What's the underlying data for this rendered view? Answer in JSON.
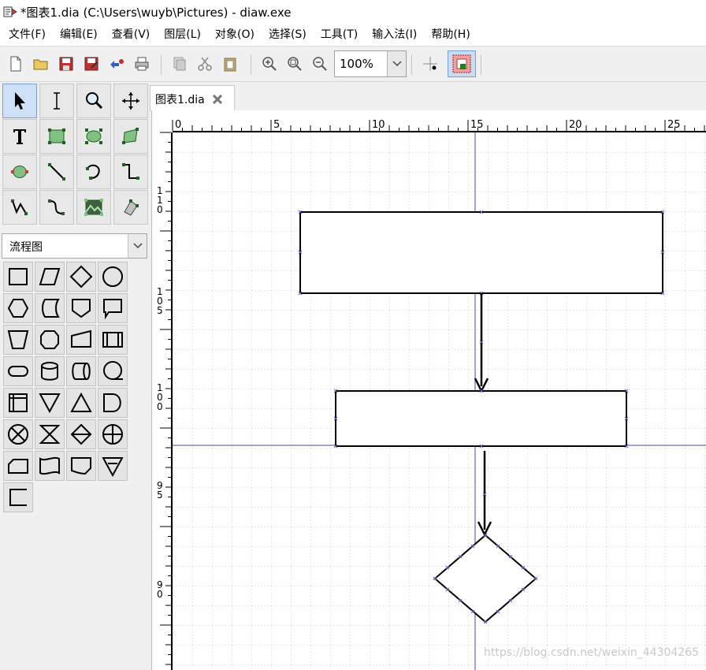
{
  "window": {
    "title": "*图表1.dia (C:\\Users\\wuyb\\Pictures) - diaw.exe"
  },
  "menu": [
    "文件(F)",
    "编辑(E)",
    "查看(V)",
    "图层(L)",
    "对象(O)",
    "选择(S)",
    "工具(T)",
    "输入法(I)",
    "帮助(H)"
  ],
  "toolbar": {
    "buttons": [
      "new-icon",
      "open-icon",
      "save-icon",
      "save-as-icon",
      "export-icon",
      "print-icon",
      "copy-icon",
      "cut-icon",
      "paste-icon",
      "zoom-in-icon",
      "zoom-fit-icon",
      "zoom-out-icon",
      "snap-grid-icon",
      "snap-objects-icon"
    ],
    "zoom_value": "100%"
  },
  "tools": [
    "pointer-icon",
    "text-cursor-icon",
    "magnify-icon",
    "move-icon",
    "text-tool-icon",
    "box-icon",
    "ellipse-icon",
    "polygon-icon",
    "bezier-icon",
    "line-icon",
    "arc-icon",
    "zigzag-icon",
    "polyline-icon",
    "bezierline-icon",
    "image-icon",
    "outline-icon"
  ],
  "sheet": {
    "selected": "流程图"
  },
  "shapes": [
    "process",
    "input-output",
    "decision",
    "connector",
    "preparation",
    "stored-data",
    "offpage",
    "document",
    "manual-operation",
    "terminator-hex",
    "manual-input",
    "predefined-process",
    "terminal",
    "magnetic-disk",
    "direct-access",
    "sequential-access",
    "internal-storage",
    "merge",
    "extract",
    "delay",
    "summing-junction",
    "collate",
    "sort",
    "or",
    "card",
    "punched-tape",
    "transaction-file",
    "merge-triangle",
    "annotation"
  ],
  "tab": {
    "label": "图表1.dia"
  },
  "ruler": {
    "h_labels": [
      "0",
      "5",
      "10",
      "15",
      "20",
      "25"
    ],
    "v_labels": [
      "1",
      "1",
      "0",
      "1",
      "0",
      "5",
      "1",
      "0",
      "0",
      "9",
      "5",
      "9",
      "0"
    ]
  },
  "watermark": "https://blog.csdn.net/weixin_44304265"
}
